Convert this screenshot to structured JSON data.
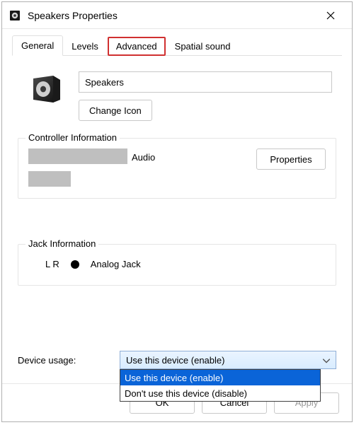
{
  "window": {
    "title": "Speakers Properties"
  },
  "tabs": {
    "general": "General",
    "levels": "Levels",
    "advanced": "Advanced",
    "spatial": "Spatial sound"
  },
  "device_name": {
    "value": "Speakers"
  },
  "buttons": {
    "change_icon": "Change Icon",
    "properties": "Properties",
    "ok": "OK",
    "cancel": "Cancel",
    "apply": "Apply"
  },
  "controller": {
    "group_label": "Controller Information",
    "audio_suffix": "Audio"
  },
  "jack": {
    "group_label": "Jack Information",
    "lr": "L R",
    "type": "Analog Jack"
  },
  "usage": {
    "label": "Device usage:",
    "selected": "Use this device (enable)",
    "options": {
      "enable": "Use this device (enable)",
      "disable": "Don't use this device (disable)"
    }
  }
}
